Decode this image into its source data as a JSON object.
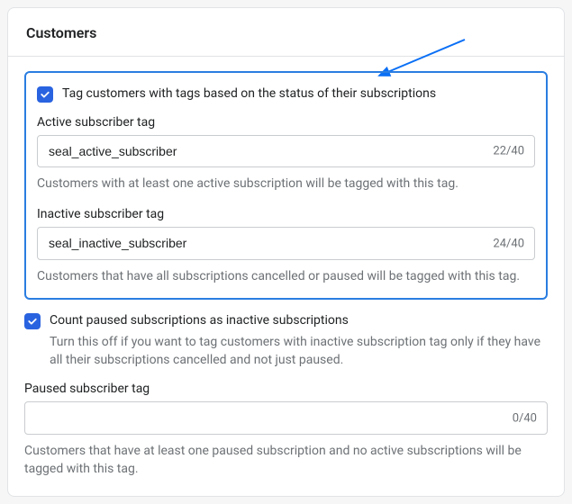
{
  "header": {
    "title": "Customers"
  },
  "tag_status": {
    "checkbox_label": "Tag customers with tags based on the status of their subscriptions",
    "checked": true
  },
  "active_tag": {
    "label": "Active subscriber tag",
    "value": "seal_active_subscriber",
    "count": "22/40",
    "help": "Customers with at least one active subscription will be tagged with this tag."
  },
  "inactive_tag": {
    "label": "Inactive subscriber tag",
    "value": "seal_inactive_subscriber",
    "count": "24/40",
    "help": "Customers that have all subscriptions cancelled or paused will be tagged with this tag."
  },
  "count_paused": {
    "checkbox_label": "Count paused subscriptions as inactive subscriptions",
    "sub": "Turn this off if you want to tag customers with inactive subscription tag only if they have all their subscriptions cancelled and not just paused.",
    "checked": true
  },
  "paused_tag": {
    "label": "Paused subscriber tag",
    "value": "",
    "count": "0/40",
    "help": "Customers that have at least one paused subscription and no active subscriptions will be tagged with this tag."
  }
}
